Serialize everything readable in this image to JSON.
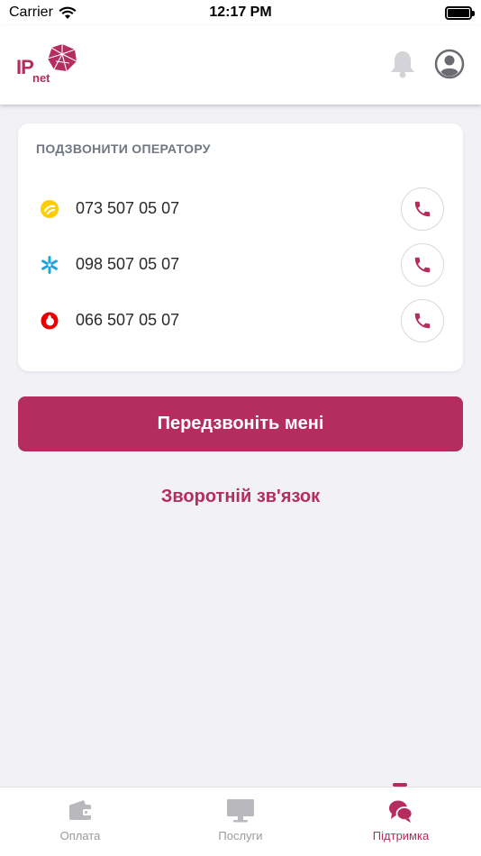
{
  "status_bar": {
    "carrier": "Carrier",
    "time": "12:17 PM"
  },
  "header": {
    "logo_ip": "IP",
    "logo_net": "net"
  },
  "card": {
    "title": "ПОДЗВОНИТИ ОПЕРАТОРУ",
    "phones": [
      {
        "operator": "lifecell",
        "number": "073 507 05 07"
      },
      {
        "operator": "kyivstar",
        "number": "098 507 05 07"
      },
      {
        "operator": "vodafone",
        "number": "066 507 05 07"
      }
    ]
  },
  "callback_button": "Передзвоніть мені",
  "feedback_link": "Зворотній зв'язок",
  "tabs": [
    {
      "label": "Оплата",
      "icon": "wallet-icon",
      "active": false
    },
    {
      "label": "Послуги",
      "icon": "monitor-icon",
      "active": false
    },
    {
      "label": "Підтримка",
      "icon": "chat-bubbles-icon",
      "active": true
    }
  ],
  "colors": {
    "accent": "#b52c5f",
    "background": "#f2f2f6",
    "tab_inactive": "#9a9aa0"
  }
}
